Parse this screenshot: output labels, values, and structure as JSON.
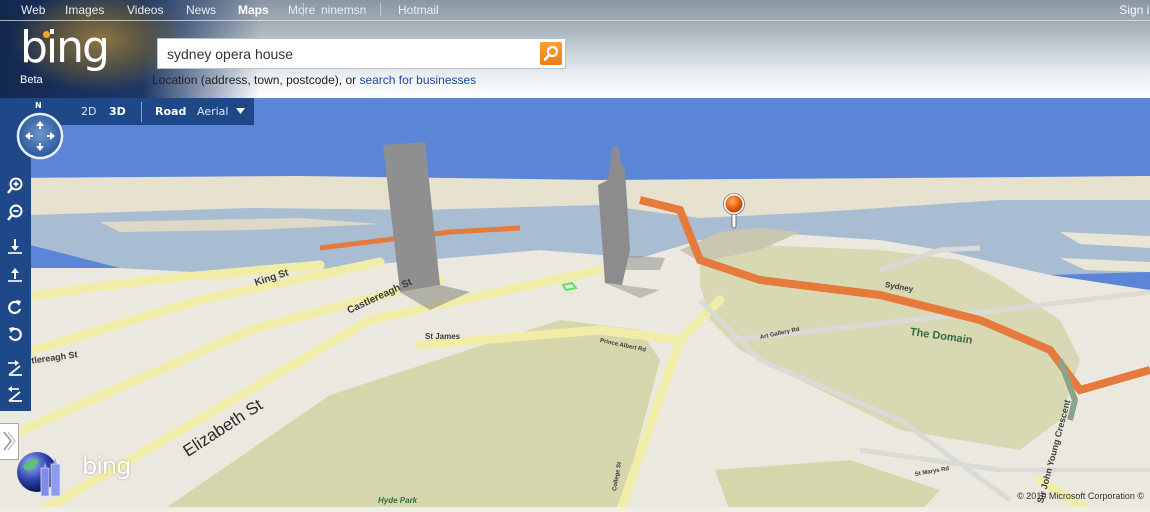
{
  "topnav": {
    "items": [
      {
        "label": "Web",
        "active": false
      },
      {
        "label": "Images",
        "active": false
      },
      {
        "label": "Videos",
        "active": false
      },
      {
        "label": "News",
        "active": false
      },
      {
        "label": "Maps",
        "active": true
      },
      {
        "label": "More",
        "active": false
      },
      {
        "label": "ninemsn",
        "active": false
      },
      {
        "label": "Hotmail",
        "active": false
      }
    ],
    "signin": "Sign in"
  },
  "brand": {
    "logo_text": "bing",
    "badge": "Beta"
  },
  "search": {
    "value": "sydney opera house",
    "button_icon": "search-icon",
    "hint_prefix": "Location (address, town, postcode), or ",
    "hint_link": "search for businesses"
  },
  "map_toolbar": {
    "view_2d": "2D",
    "view_3d": "3D",
    "style_road": "Road",
    "style_aerial": "Aerial",
    "dropdown_icon": "triangle-down-icon",
    "compass_label": "N"
  },
  "side_controls": [
    {
      "name": "zoom-in",
      "icon": "zoom-in-icon"
    },
    {
      "name": "zoom-out",
      "icon": "zoom-out-icon"
    },
    {
      "name": "tilt-down",
      "icon": "arrow-down-bar-icon"
    },
    {
      "name": "tilt-up",
      "icon": "arrow-up-bar-icon"
    },
    {
      "name": "rotate-clockwise",
      "icon": "rotate-cw-icon"
    },
    {
      "name": "rotate-counterclockwise",
      "icon": "rotate-ccw-icon"
    },
    {
      "name": "tilt-right",
      "icon": "tilt-right-icon"
    },
    {
      "name": "tilt-left",
      "icon": "tilt-left-icon"
    }
  ],
  "map_labels": {
    "king_st": "King St",
    "castlereagh_st": "Castlereagh St",
    "castlereagh_st_2": "Castlereagh St",
    "elizabeth_st": "Elizabeth St",
    "st_james": "St James",
    "the_domain": "The Domain",
    "sydney": "Sydney",
    "hyde_park": "Hyde Park",
    "sir_john_young": "Sir John Young Crescent",
    "art_gallery_rd": "Art Gallery Rd",
    "prince_albert_rd": "Prince Albert Rd",
    "st_marys_rd": "St Marys Rd",
    "college_st": "College St"
  },
  "watermark": "bing",
  "copyright": "© 2010 Microsoft Corporation ©",
  "colors": {
    "toolbar_bg": "#1f4888",
    "sky": "#5b86d8",
    "water": "#a9bdd2",
    "land": "#ebe8df",
    "park": "#d8d8b0",
    "highway": "#e57a3c",
    "road": "#f0eda9",
    "search_button": "#f28a1c",
    "link": "#1f4aa5"
  }
}
